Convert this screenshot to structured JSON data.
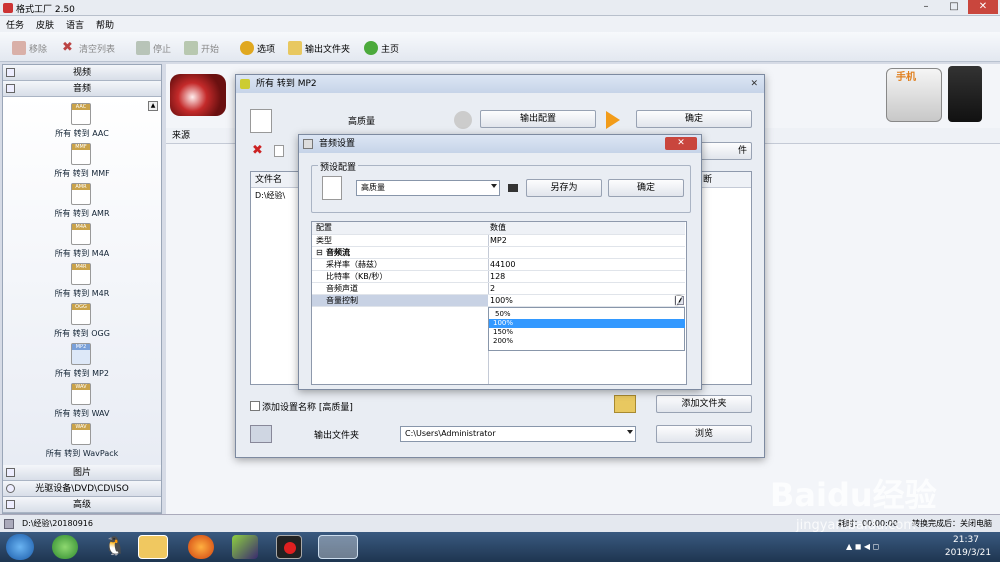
{
  "app": {
    "title": "格式工厂 2.50"
  },
  "menu": [
    "任务",
    "皮肤",
    "语言",
    "帮助"
  ],
  "toolbar": {
    "remove": "移除",
    "clear": "清空列表",
    "stop": "停止",
    "start": "开始",
    "options": "选项",
    "output_folder": "输出文件夹",
    "home": "主页"
  },
  "sidebar": {
    "video": "视频",
    "audio": "音频",
    "formats": [
      {
        "badge": "AAC",
        "label": "所有 转到 AAC"
      },
      {
        "badge": "MMF",
        "label": "所有 转到 MMF"
      },
      {
        "badge": "AMR",
        "label": "所有 转到 AMR"
      },
      {
        "badge": "M4A",
        "label": "所有 转到 M4A"
      },
      {
        "badge": "M4R",
        "label": "所有 转到 M4R"
      },
      {
        "badge": "OGG",
        "label": "所有 转到 OGG"
      },
      {
        "badge": "MP2",
        "label": "所有 转到 MP2"
      },
      {
        "badge": "WAV",
        "label": "所有 转到 WAV"
      },
      {
        "badge": "WAV",
        "label": "所有 转到 WavPack"
      }
    ],
    "picture": "图片",
    "optical": "光驱设备\\DVD\\CD\\ISO",
    "advanced": "高级"
  },
  "main": {
    "source_col": "来源",
    "phone_label": "手机"
  },
  "mp2_dialog": {
    "title": "所有 转到 MP2",
    "quality": "高质量",
    "output_config_btn": "输出配置",
    "ok_btn": "确定",
    "file_btn_partial": "件",
    "file_name_col": "文件名",
    "file_entry": "D:\\经验\\",
    "col_partial": "断",
    "add_setting_name": "添加设置名称 [高质量]",
    "add_file_btn": "添加文件夹",
    "output_folder_label": "输出文件夹",
    "output_folder_value": "C:\\Users\\Administrator",
    "browse_btn": "浏览"
  },
  "audio_dialog": {
    "title": "音频设置",
    "preset_group": "预设配置",
    "preset_value": "高质量",
    "save_as_btn": "另存为",
    "ok_btn": "确定",
    "grid_header_key": "配置",
    "grid_header_value": "数值",
    "rows": [
      {
        "key": "类型",
        "value": "MP2",
        "indent": false
      },
      {
        "key": "音频流",
        "value": "",
        "indent": false,
        "group": true
      },
      {
        "key": "采样率（赫兹）",
        "value": "44100",
        "indent": true
      },
      {
        "key": "比特率（KB/秒）",
        "value": "128",
        "indent": true
      },
      {
        "key": "音频声道",
        "value": "2",
        "indent": true
      },
      {
        "key": "音量控制",
        "value": "100%",
        "indent": true,
        "selected": true
      }
    ],
    "dropdown_options": [
      "50%",
      "100%",
      "150%",
      "200%"
    ],
    "dropdown_selected": "100%"
  },
  "status": {
    "path": "D:\\经验\\20180916",
    "right_text_1": "耗时：00:00:00",
    "right_text_2": "转换完成后：关闭电脑"
  },
  "clock": {
    "time": "21:37",
    "date": "2019/3/21"
  },
  "watermark": {
    "brand": "Baidu经验",
    "url": "jingyan.baidu.com"
  }
}
